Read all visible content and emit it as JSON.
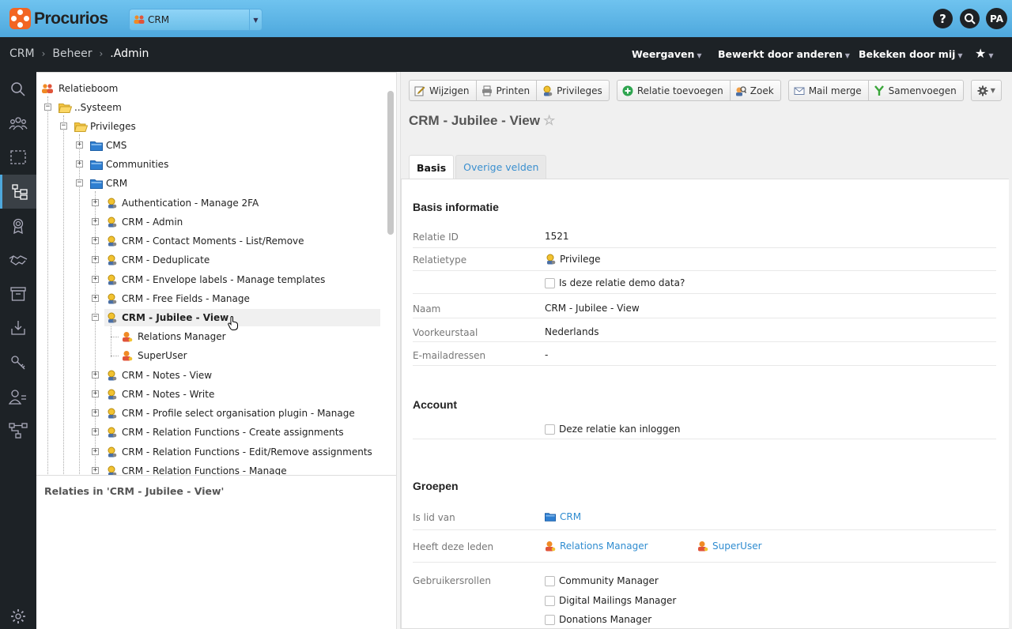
{
  "app": {
    "brand": "Procurios",
    "brand_color": "#f26522",
    "module": "CRM"
  },
  "topbar": {
    "help": "?",
    "search_icon": "search-icon",
    "avatar": "PA"
  },
  "breadcrumb": [
    "CRM",
    "Beheer",
    ".Admin"
  ],
  "navmenu": {
    "views": "Weergaven",
    "edited": "Bewerkt door anderen",
    "viewed": "Bekeken door mij"
  },
  "sidebar": [
    "search-icon",
    "people-icon",
    "selection-icon",
    "tree-icon",
    "badge-icon",
    "handshake-icon",
    "archive-icon",
    "download-icon",
    "key-icon",
    "user-group-icon",
    "workflow-icon",
    "settings-icon"
  ],
  "tree": {
    "root": "Relatieboom",
    "nodes": [
      {
        "label": "..Systeem"
      },
      {
        "label": "Privileges"
      },
      {
        "label": "CMS"
      },
      {
        "label": "Communities"
      },
      {
        "label": "CRM"
      },
      {
        "label": "Authentication - Manage 2FA"
      },
      {
        "label": "CRM - Admin"
      },
      {
        "label": "CRM - Contact Moments - List/Remove"
      },
      {
        "label": "CRM - Deduplicate"
      },
      {
        "label": "CRM - Envelope labels - Manage templates"
      },
      {
        "label": "CRM - Free Fields - Manage"
      },
      {
        "label": "CRM - Jubilee - View"
      },
      {
        "label": "Relations Manager"
      },
      {
        "label": "SuperUser"
      },
      {
        "label": "CRM - Notes - View"
      },
      {
        "label": "CRM - Notes - Write"
      },
      {
        "label": "CRM - Profile select organisation plugin - Manage"
      },
      {
        "label": "CRM - Relation Functions - Create assignments"
      },
      {
        "label": "CRM - Relation Functions - Edit/Remove assignments"
      },
      {
        "label": "CRM - Relation Functions - Manage"
      }
    ]
  },
  "relations_pane": {
    "title": "Relaties in 'CRM - Jubilee - View'"
  },
  "toolbar": {
    "edit": "Wijzigen",
    "print": "Printen",
    "privileges": "Privileges",
    "add": "Relatie toevoegen",
    "search": "Zoek",
    "mail": "Mail merge",
    "merge": "Samenvoegen"
  },
  "record": {
    "title": "CRM - Jubilee - View",
    "star": "☆"
  },
  "tabs": [
    "Basis",
    "Overige velden"
  ],
  "basis": {
    "title": "Basis informatie",
    "id_label": "Relatie ID",
    "id": "1521",
    "type_label": "Relatietype",
    "type": "Privilege",
    "demo": "Is deze relatie demo data?",
    "name_label": "Naam",
    "name": "CRM - Jubilee - View",
    "lang_label": "Voorkeurstaal",
    "lang": "Nederlands",
    "email_label": "E-mailadressen",
    "email": "-"
  },
  "account": {
    "title": "Account",
    "login": "Deze relatie kan inloggen"
  },
  "groups": {
    "title": "Groepen",
    "member_label": "Is lid van",
    "member": "CRM",
    "members_label": "Heeft deze leden",
    "members": [
      "Relations Manager",
      "SuperUser"
    ],
    "roles_label": "Gebruikersrollen",
    "roles": [
      "Community Manager",
      "Digital Mailings Manager",
      "Donations Manager"
    ]
  }
}
